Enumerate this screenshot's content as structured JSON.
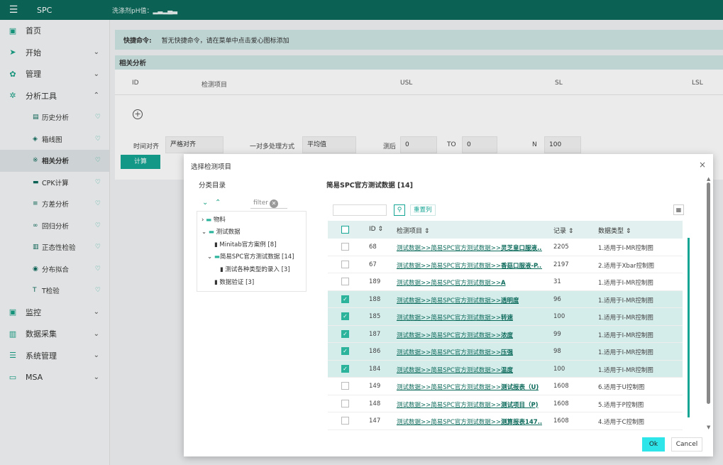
{
  "topbar": {
    "menu_icon": "☰",
    "app_name": "SPC",
    "breadcrumb": "洗涤剂pH值：▂▃▂▄▃"
  },
  "sidebar": {
    "items": [
      {
        "label": "首页",
        "icon": "▣",
        "chevron": ""
      },
      {
        "label": "开始",
        "icon": "➤",
        "chevron": "⌄"
      },
      {
        "label": "管理",
        "icon": "✿",
        "chevron": "⌄"
      },
      {
        "label": "分析工具",
        "icon": "✲",
        "chevron": "⌃"
      }
    ],
    "subitems": [
      {
        "label": "历史分析",
        "icon": "▤"
      },
      {
        "label": "箱线图",
        "icon": "◈"
      },
      {
        "label": "相关分析",
        "icon": "※"
      },
      {
        "label": "CPK计算",
        "icon": "▬"
      },
      {
        "label": "方差分析",
        "icon": "≡"
      },
      {
        "label": "回归分析",
        "icon": "∞"
      },
      {
        "label": "正态性检验",
        "icon": "▥"
      },
      {
        "label": "分布拟合",
        "icon": "◉"
      },
      {
        "label": "T检验",
        "icon": "T"
      }
    ],
    "items_bottom": [
      {
        "label": "监控",
        "icon": "▣",
        "chevron": "⌄"
      },
      {
        "label": "数据采集",
        "icon": "▥",
        "chevron": "⌄"
      },
      {
        "label": "系统管理",
        "icon": "☰",
        "chevron": "⌄"
      },
      {
        "label": "MSA",
        "icon": "▭",
        "chevron": "⌄"
      }
    ],
    "heart": "♡"
  },
  "quickbar": {
    "label": "快捷命令:",
    "text": "暂无快捷命令，请在菜单中点击爱心图标添加"
  },
  "panel": {
    "title": "相关分析",
    "columns": [
      "ID",
      "检测项目",
      "USL",
      "SL",
      "LSL"
    ],
    "add_icon": "+",
    "params": {
      "time_align_label": "时间对齐",
      "time_align_value": "严格对齐",
      "multi_label": "一对多处理方式",
      "multi_value": "平均值",
      "before_label": "测后",
      "before_value": "0",
      "to_label": "TO",
      "to_value": "0",
      "n_label": "N",
      "n_value": "100"
    },
    "calc_label": "计算"
  },
  "modal": {
    "title": "选择检测项目",
    "close": "×",
    "tree": {
      "title": "分类目录",
      "filter_placeholder": "filter",
      "nodes": [
        "物料",
        "测试数据",
        "Minitab官方案例 [8]",
        "简易SPC官方测试数据 [14]",
        "测试各种类型的录入 [3]",
        "数据验证 [3]"
      ]
    },
    "right_title": "简易SPC官方测试数据 [14]",
    "reset_label": "重置列",
    "headers": [
      "ID ⇕",
      "检测项目 ⇕",
      "记录 ⇕",
      "数据类型 ⇕"
    ],
    "rows": [
      {
        "checked": false,
        "id": "68",
        "prefix": "测试数据>>简易SPC官方测试数据>>",
        "name": "灵芝皇口服液...",
        "count": "2205",
        "type": "1.适用于I-MR控制图"
      },
      {
        "checked": false,
        "id": "67",
        "prefix": "测试数据>>简易SPC官方测试数据>>",
        "name": "香菇口服液-P...",
        "count": "2197",
        "type": "2.适用于Xbar控制图"
      },
      {
        "checked": false,
        "id": "189",
        "prefix": "测试数据>>简易SPC官方测试数据>>",
        "name": "A",
        "count": "31",
        "type": "1.适用于I-MR控制图"
      },
      {
        "checked": true,
        "id": "188",
        "prefix": "测试数据>>简易SPC官方测试数据>>",
        "name": "透明度",
        "count": "96",
        "type": "1.适用于I-MR控制图"
      },
      {
        "checked": true,
        "id": "185",
        "prefix": "测试数据>>简易SPC官方测试数据>>",
        "name": "转速",
        "count": "100",
        "type": "1.适用于I-MR控制图"
      },
      {
        "checked": true,
        "id": "187",
        "prefix": "测试数据>>简易SPC官方测试数据>>",
        "name": "浓度",
        "count": "99",
        "type": "1.适用于I-MR控制图"
      },
      {
        "checked": true,
        "id": "186",
        "prefix": "测试数据>>简易SPC官方测试数据>>",
        "name": "压强",
        "count": "98",
        "type": "1.适用于I-MR控制图"
      },
      {
        "checked": true,
        "id": "184",
        "prefix": "测试数据>>简易SPC官方测试数据>>",
        "name": "温度",
        "count": "100",
        "type": "1.适用于I-MR控制图"
      },
      {
        "checked": false,
        "id": "149",
        "prefix": "测试数据>>简易SPC官方测试数据>>",
        "name": "测试报表（U)",
        "count": "1608",
        "type": "6.适用于U控制图"
      },
      {
        "checked": false,
        "id": "148",
        "prefix": "测试数据>>简易SPC官方测试数据>>",
        "name": "测试项目（P)",
        "count": "1608",
        "type": "5.适用于P控制图"
      },
      {
        "checked": false,
        "id": "147",
        "prefix": "测试数据>>简易SPC官方测试数据>>",
        "name": "测算报表147...",
        "count": "1608",
        "type": "4.适用于C控制图"
      }
    ],
    "ok_label": "Ok",
    "cancel_label": "Cancel"
  }
}
